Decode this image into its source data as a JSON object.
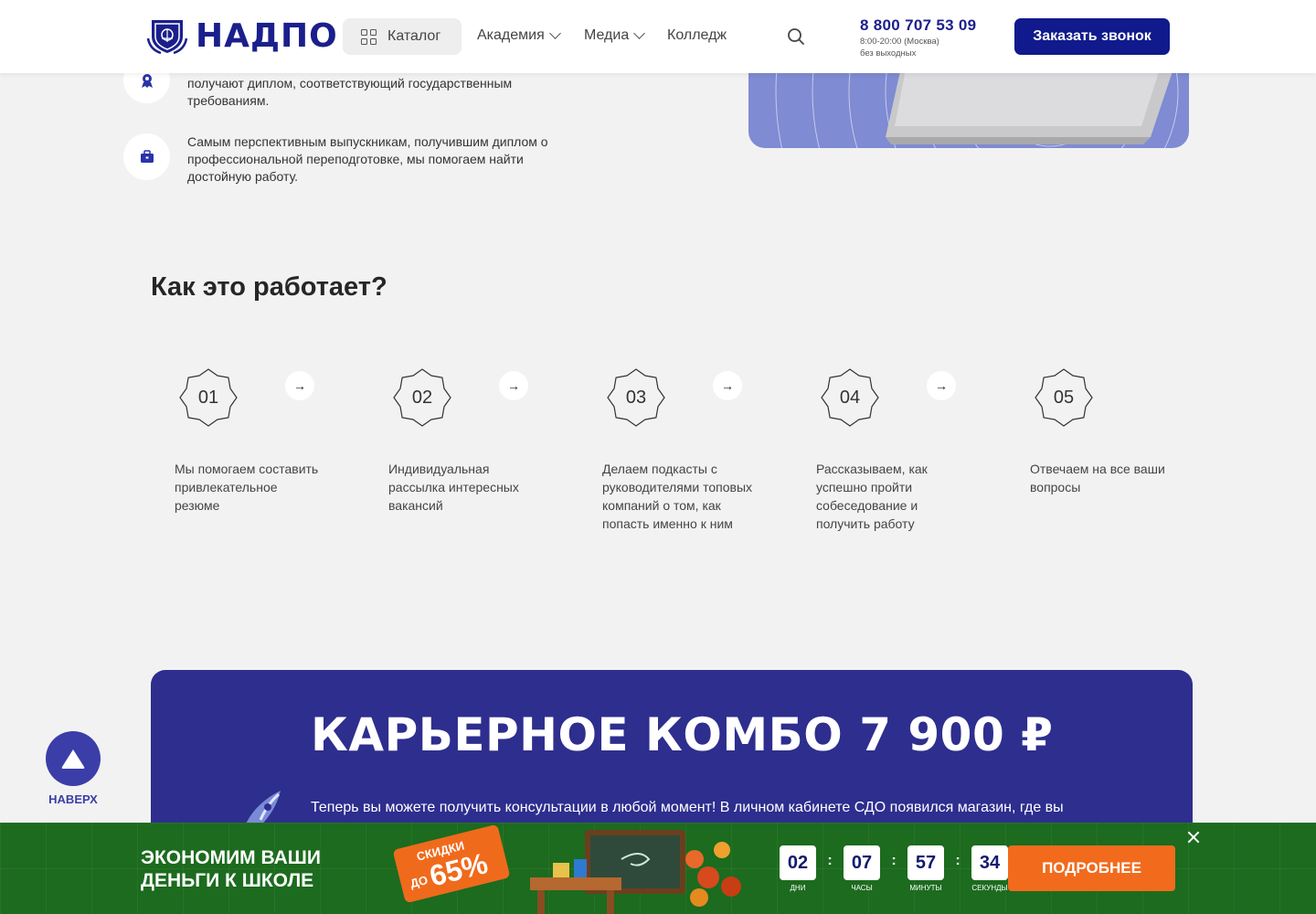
{
  "header": {
    "logo_text": "НАДПО",
    "catalog_label": "Каталог",
    "nav": [
      {
        "label": "Академия"
      },
      {
        "label": "Медиа"
      },
      {
        "label": "Колледж"
      }
    ],
    "phone": "8 800 707 53 09",
    "hours_line1": "8:00-20:00 (Москва)",
    "hours_line2": "без выходных",
    "call_button": "Заказать звонок"
  },
  "benefits": [
    {
      "icon": "award-icon",
      "text": "получают диплом, соответствующий государственным требованиям."
    },
    {
      "icon": "briefcase-icon",
      "text": "Самым перспективным выпускникам, получившим диплом о профессиональной переподготовке, мы помогаем найти достойную работу."
    }
  ],
  "how_it_works": {
    "title": "Как это работает?",
    "steps": [
      {
        "num": "01",
        "text": "Мы помогаем составить привлекательное резюме"
      },
      {
        "num": "02",
        "text": "Индивидуальная рассылка интересных вакансий"
      },
      {
        "num": "03",
        "text": "Делаем подкасты с руководителями топовых компаний о том, как попасть именно к ним"
      },
      {
        "num": "04",
        "text": "Рассказываем, как успешно пройти собеседование и получить работу"
      },
      {
        "num": "05",
        "text": "Отвечаем на все ваши вопросы"
      }
    ]
  },
  "combo": {
    "title": "КАРЬЕРНОЕ КОМБО 7 900 ₽",
    "text": "Теперь вы можете получить консультации в любой момент! В личном кабинете СДО появился магазин, где вы"
  },
  "to_top": {
    "label": "НАВЕРХ"
  },
  "promo_bar": {
    "title": "ЭКОНОМИМ ВАШИ ДЕНЬГИ К ШКОЛЕ",
    "sale_top": "СКИДКИ",
    "sale_up": "ДО",
    "sale_pct": "65%",
    "timer": [
      {
        "value": "02",
        "label": "ДНИ"
      },
      {
        "value": "07",
        "label": "ЧАСЫ"
      },
      {
        "value": "57",
        "label": "МИНУТЫ"
      },
      {
        "value": "34",
        "label": "СЕКУНДЫ"
      }
    ],
    "more_button": "ПОДРОБНЕЕ"
  },
  "colors": {
    "brand": "#101a8c",
    "combo_bg": "#2d2e8e",
    "promo_bg": "#1c6b1e",
    "accent_orange": "#f26b1d"
  }
}
